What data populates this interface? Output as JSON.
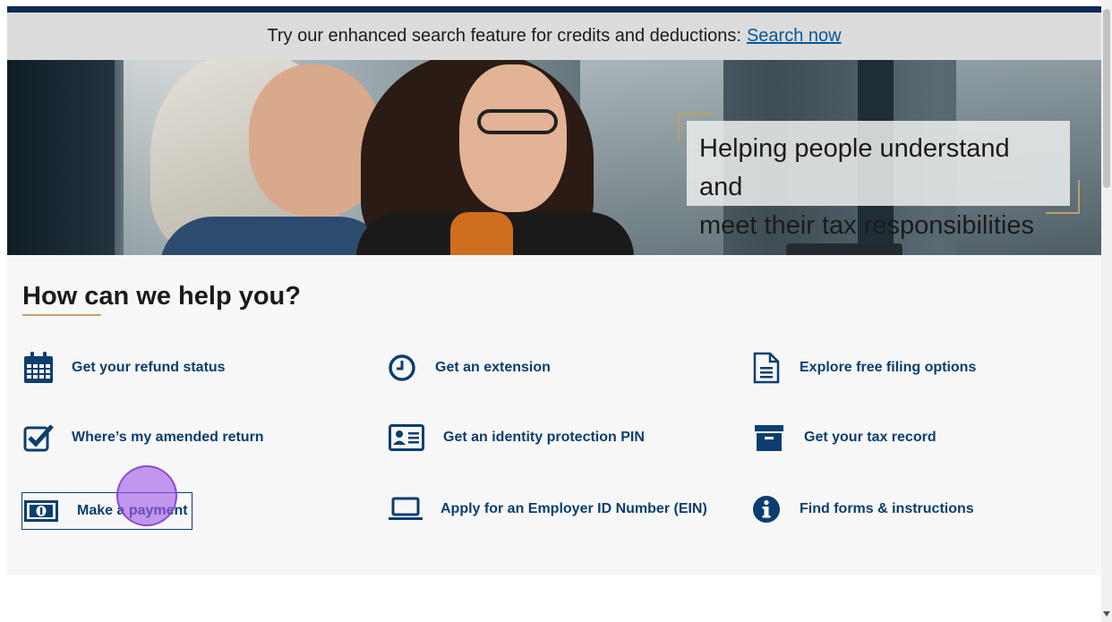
{
  "banner": {
    "text": "Try our enhanced search feature for credits and deductions:",
    "link": "Search now"
  },
  "hero": {
    "line1": "Helping people understand and",
    "line2": "meet their tax responsibilities"
  },
  "help": {
    "title": "How can we help you?",
    "items": [
      {
        "label": "Get your refund status",
        "icon": "calendar-icon"
      },
      {
        "label": "Get an extension",
        "icon": "clock-icon"
      },
      {
        "label": "Explore free filing options",
        "icon": "document-icon"
      },
      {
        "label": "Where’s my amended return",
        "icon": "checkbox-icon"
      },
      {
        "label": "Get an identity protection PIN",
        "icon": "id-card-icon"
      },
      {
        "label": "Get your tax record",
        "icon": "archive-box-icon"
      },
      {
        "label": "Make a payment",
        "icon": "money-bill-icon"
      },
      {
        "label": "Apply for an Employer ID Number (EIN)",
        "icon": "laptop-icon"
      },
      {
        "label": "Find forms & instructions",
        "icon": "info-icon"
      }
    ]
  },
  "colors": {
    "link": "#0b3e6f",
    "accent": "#c4a46a",
    "topbar": "#0b2a55"
  }
}
